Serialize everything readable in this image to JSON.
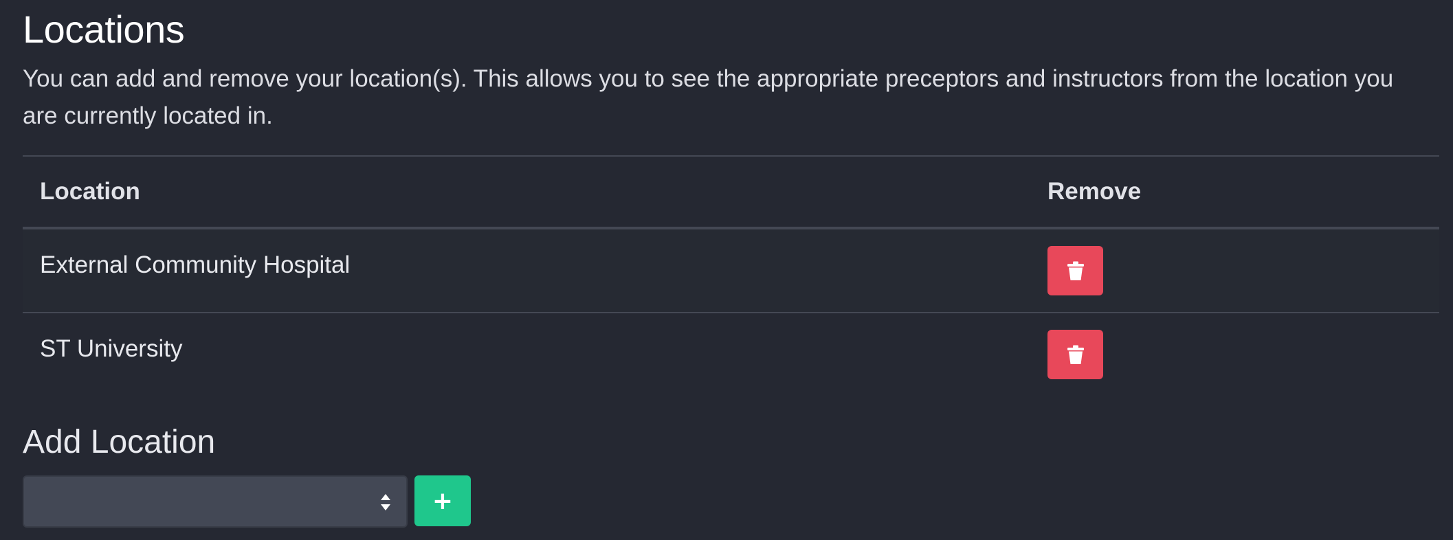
{
  "header": {
    "title": "Locations",
    "description": "You can add and remove your location(s). This allows you to see the appropriate preceptors and instructors from the location you are currently located in."
  },
  "table": {
    "columns": [
      "Location",
      "Remove"
    ],
    "rows": [
      {
        "location": "External Community Hospital",
        "remove_icon": "trash-icon"
      },
      {
        "location": "ST University",
        "remove_icon": "trash-icon"
      }
    ]
  },
  "add_location": {
    "title": "Add Location",
    "select_value": "",
    "add_label": "+"
  },
  "colors": {
    "background": "#252832",
    "danger": "#e8485a",
    "success": "#1fc78c"
  }
}
